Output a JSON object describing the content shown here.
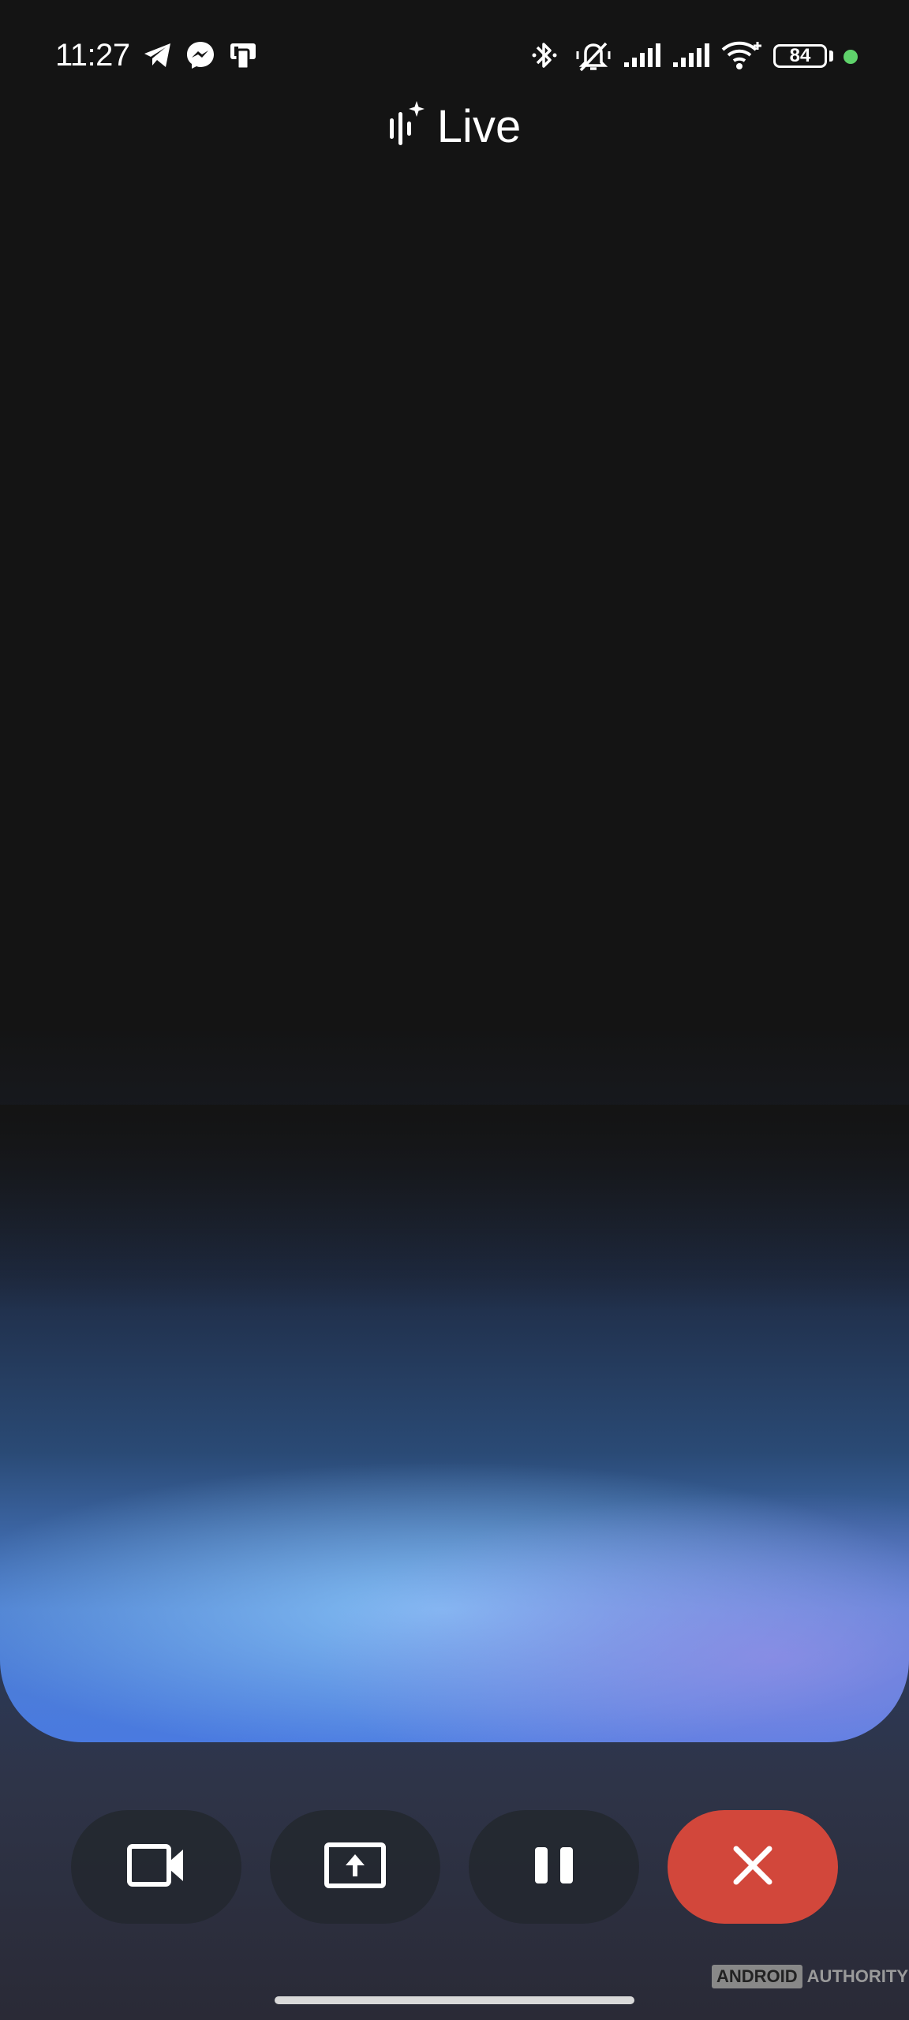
{
  "status_bar": {
    "time": "11:27",
    "battery_level": "84",
    "icons": [
      "telegram-icon",
      "messenger-icon",
      "app-notification-icon",
      "bluetooth-icon",
      "vibrate-off-icon",
      "signal-icon",
      "signal-icon",
      "wifi-icon",
      "battery-icon",
      "privacy-dot-icon"
    ]
  },
  "header": {
    "title": "Live",
    "icon": "gemini-live-icon"
  },
  "controls": [
    {
      "name": "camera",
      "icon": "video-camera-icon"
    },
    {
      "name": "share-screen",
      "icon": "screen-share-icon"
    },
    {
      "name": "pause",
      "icon": "pause-icon"
    },
    {
      "name": "end",
      "icon": "close-icon",
      "color": "#d2473b"
    }
  ],
  "watermark": {
    "left": "ANDROID",
    "right": "AUTHORITY"
  },
  "colors": {
    "background": "#141414",
    "end_button": "#d2473b",
    "privacy_dot": "#5fd26b"
  }
}
